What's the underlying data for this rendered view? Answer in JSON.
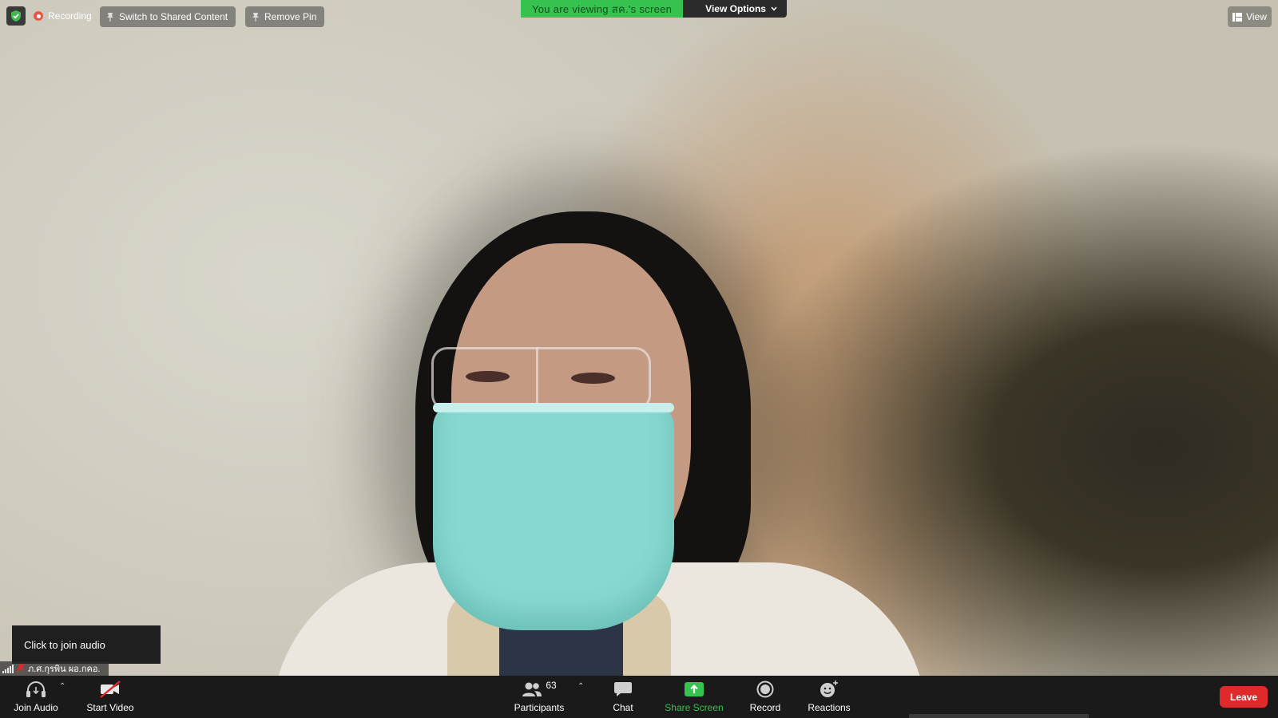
{
  "top_bar": {
    "recording_label": "Recording",
    "switch_label": "Switch to Shared Content",
    "remove_pin_label": "Remove Pin",
    "viewing_text": "You are viewing สค.'s screen",
    "view_options_label": "View Options",
    "view_label": "View"
  },
  "tooltip": {
    "text": "Click to join audio"
  },
  "nameplate": {
    "name": "ภ.ศ.กุรพิน ผอ.กคอ."
  },
  "toolbar": {
    "join_audio": "Join Audio",
    "start_video": "Start Video",
    "participants_label": "Participants",
    "participants_count": "63",
    "chat": "Chat",
    "share_screen": "Share Screen",
    "record": "Record",
    "reactions": "Reactions",
    "leave": "Leave"
  },
  "colors": {
    "share_green": "#35c24f",
    "leave_red": "#e0292b",
    "recording_red": "#e8574b",
    "shield_green": "#3fb950"
  }
}
